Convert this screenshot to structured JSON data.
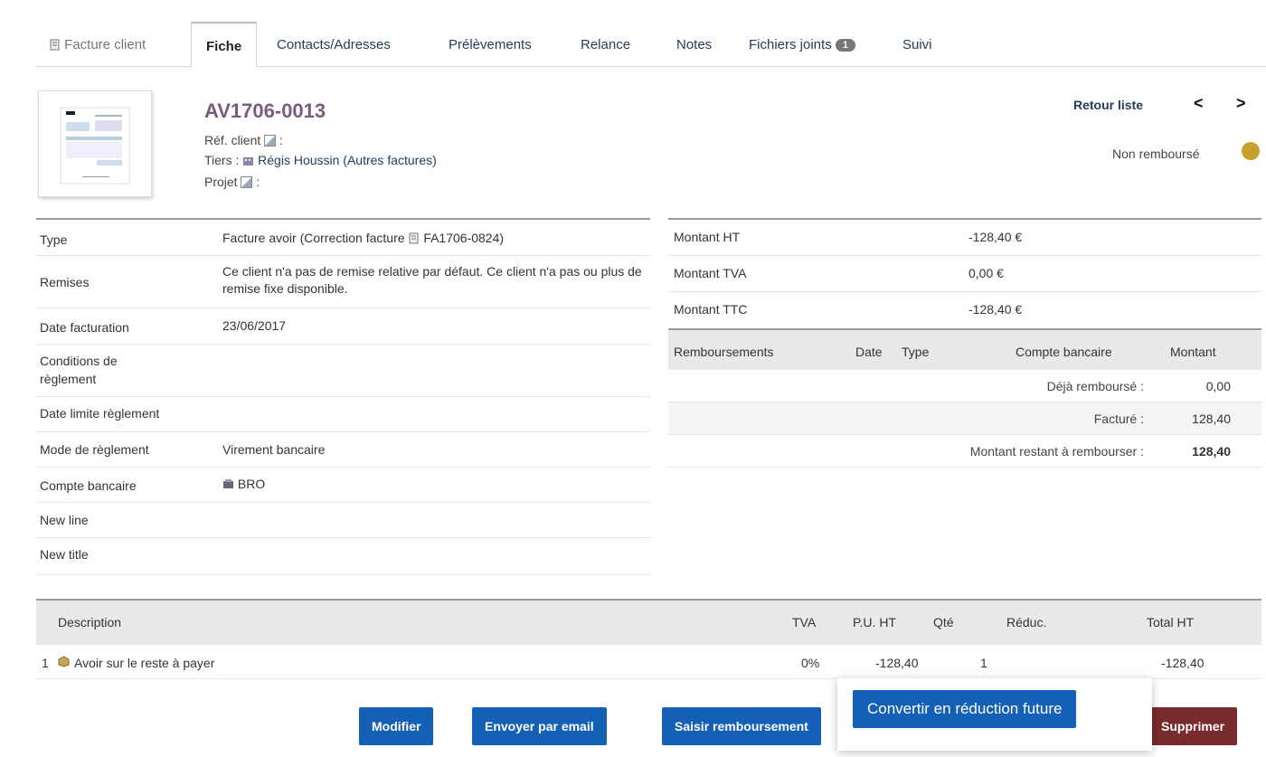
{
  "tabs": [
    {
      "label": "Facture client"
    },
    {
      "label": "Fiche"
    },
    {
      "label": "Contacts/Adresses"
    },
    {
      "label": "Prélèvements"
    },
    {
      "label": "Relance"
    },
    {
      "label": "Notes"
    },
    {
      "label": "Fichiers joints",
      "badge": "1"
    },
    {
      "label": "Suivi"
    }
  ],
  "header": {
    "ref": "AV1706-0013",
    "ref_client_label": "Réf. client",
    "tiers_label": "Tiers :",
    "tiers_value": "Régis Houssin (Autres factures)",
    "projet_label": "Projet",
    "retour": "Retour liste",
    "prev": "<",
    "next": ">",
    "status": "Non remboursé",
    "status_color": "#c9a02b"
  },
  "left_fields": [
    {
      "label": "Type",
      "value": "Facture avoir (Correction facture",
      "link": "FA1706-0824)"
    },
    {
      "label": "Remises",
      "value": "Ce client n'a pas de remise relative par défaut. Ce client n'a pas ou plus de remise fixe disponible."
    },
    {
      "label": "Date facturation",
      "value": "23/06/2017"
    },
    {
      "label": "Conditions de règlement",
      "value": ""
    },
    {
      "label": "Date limite règlement",
      "value": ""
    },
    {
      "label": "Mode de règlement",
      "value": "Virement bancaire"
    },
    {
      "label": "Compte bancaire",
      "value": "BRO"
    },
    {
      "label": "New line",
      "value": ""
    },
    {
      "label": "New title",
      "value": ""
    }
  ],
  "amounts": [
    {
      "label": "Montant HT",
      "value": "-128,40 €"
    },
    {
      "label": "Montant TVA",
      "value": "0,00 €"
    },
    {
      "label": "Montant TTC",
      "value": "-128,40 €"
    }
  ],
  "refunds": {
    "headers": [
      "Remboursements",
      "Date",
      "Type",
      "Compte bancaire",
      "Montant"
    ],
    "summary": [
      {
        "label": "Déjà remboursé :",
        "value": "0,00"
      },
      {
        "label": "Facturé :",
        "value": "128,40"
      },
      {
        "label": "Montant restant à rembourser :",
        "value": "128,40"
      }
    ]
  },
  "lines": {
    "headers": [
      "Description",
      "TVA",
      "P.U. HT",
      "Qté",
      "Réduc.",
      "Total HT"
    ],
    "rows": [
      {
        "num": "1",
        "desc": "Avoir sur le reste à payer",
        "tva": "0%",
        "pu": "-128,40",
        "qty": "1",
        "reduc": "",
        "total": "-128,40"
      }
    ]
  },
  "buttons": {
    "modifier": "Modifier",
    "email": "Envoyer par email",
    "rembourse": "Saisir remboursement",
    "convert": "Convertir en réduction future",
    "supprimer": "Supprimer"
  },
  "accent_color": "#1560b7"
}
